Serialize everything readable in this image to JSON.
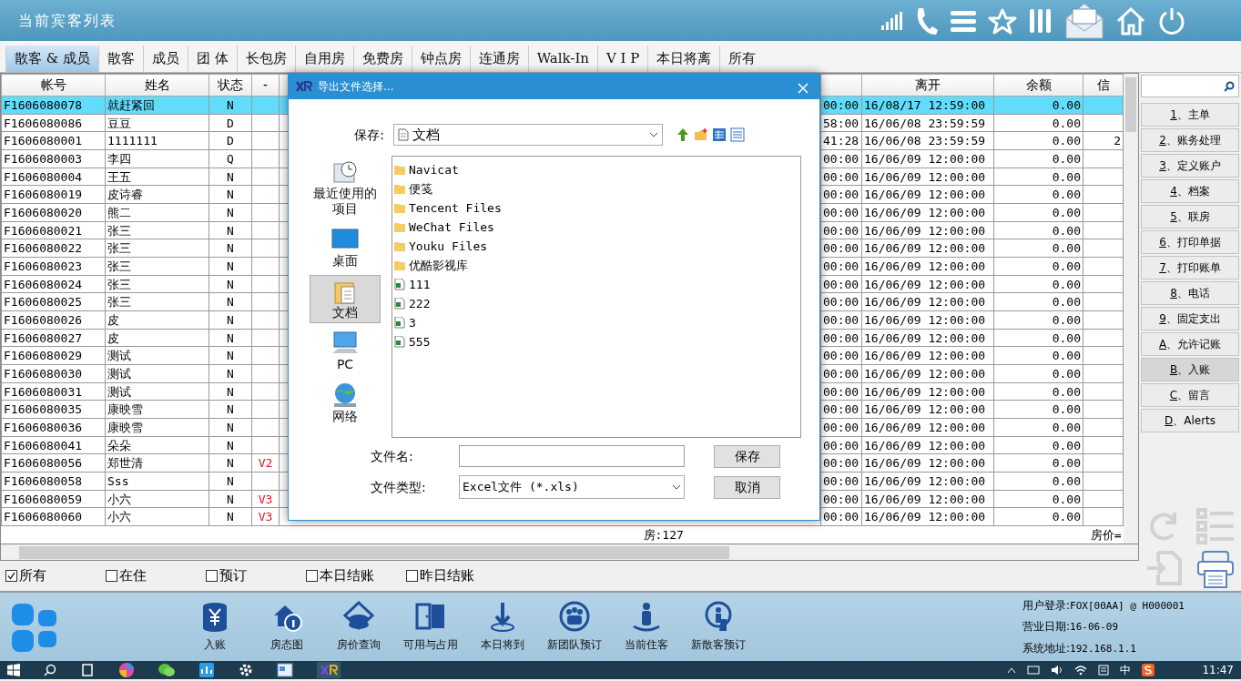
{
  "title_bar": {
    "title": "当前宾客列表"
  },
  "tabs": [
    {
      "label": "散客 & 成员",
      "selected": true
    },
    {
      "label": "散客",
      "selected": false
    },
    {
      "label": "成员",
      "selected": false
    },
    {
      "label": "团 体",
      "selected": false
    },
    {
      "label": "长包房",
      "selected": false
    },
    {
      "label": "自用房",
      "selected": false
    },
    {
      "label": "免费房",
      "selected": false
    },
    {
      "label": "钟点房",
      "selected": false
    },
    {
      "label": "连通房",
      "selected": false
    },
    {
      "label": "Walk-In",
      "selected": false
    },
    {
      "label": "V I P",
      "selected": false
    },
    {
      "label": "本日将离",
      "selected": false
    },
    {
      "label": "所有",
      "selected": false
    }
  ],
  "table": {
    "columns": [
      "帐号",
      "姓名",
      "状态",
      "-",
      "离开",
      "余额",
      "信"
    ],
    "rows": [
      {
        "account": "F1606080078",
        "name": "就赶紧回",
        "status": "N",
        "column_4": "",
        "column_6": "00:00",
        "leave": "16/08/17 12:59:00",
        "balance": "0.00",
        "column_9": "",
        "selected": true
      },
      {
        "account": "F1606080086",
        "name": "豆豆",
        "status": "D",
        "column_6": "58:00",
        "leave": "16/06/08 23:59:59",
        "balance": "0.00",
        "selected": false
      },
      {
        "account": "F1606080001",
        "name": "1111111",
        "status": "D",
        "column_6": "41:28",
        "leave": "16/06/08 23:59:59",
        "balance": "0.00",
        "column_9": "2",
        "selected": false
      },
      {
        "account": "F1606080003",
        "name": "李四",
        "status": "Q",
        "column_6": "00:00",
        "leave": "16/06/09 12:00:00",
        "balance": "0.00",
        "selected": false
      },
      {
        "account": "F1606080004",
        "name": "王五",
        "status": "N",
        "column_6": "00:00",
        "leave": "16/06/09 12:00:00",
        "balance": "0.00",
        "selected": false
      },
      {
        "account": "F1606080019",
        "name": "皮诗睿",
        "status": "N",
        "column_6": "00:00",
        "leave": "16/06/09 12:00:00",
        "balance": "0.00",
        "selected": false
      },
      {
        "account": "F1606080020",
        "name": "熊二",
        "status": "N",
        "column_6": "00:00",
        "leave": "16/06/09 12:00:00",
        "balance": "0.00",
        "selected": false
      },
      {
        "account": "F1606080021",
        "name": "张三",
        "status": "N",
        "column_6": "00:00",
        "leave": "16/06/09 12:00:00",
        "balance": "0.00",
        "selected": false
      },
      {
        "account": "F1606080022",
        "name": "张三",
        "status": "N",
        "column_6": "00:00",
        "leave": "16/06/09 12:00:00",
        "balance": "0.00",
        "selected": false
      },
      {
        "account": "F1606080023",
        "name": "张三",
        "status": "N",
        "column_6": "00:00",
        "leave": "16/06/09 12:00:00",
        "balance": "0.00",
        "selected": false
      },
      {
        "account": "F1606080024",
        "name": "张三",
        "status": "N",
        "column_6": "00:00",
        "leave": "16/06/09 12:00:00",
        "balance": "0.00",
        "selected": false
      },
      {
        "account": "F1606080025",
        "name": "张三",
        "status": "N",
        "column_6": "00:00",
        "leave": "16/06/09 12:00:00",
        "balance": "0.00",
        "selected": false
      },
      {
        "account": "F1606080026",
        "name": "皮",
        "status": "N",
        "column_6": "00:00",
        "leave": "16/06/09 12:00:00",
        "balance": "0.00",
        "selected": false
      },
      {
        "account": "F1606080027",
        "name": "皮",
        "status": "N",
        "column_6": "00:00",
        "leave": "16/06/09 12:00:00",
        "balance": "0.00",
        "selected": false
      },
      {
        "account": "F1606080029",
        "name": "测试",
        "status": "N",
        "column_6": "00:00",
        "leave": "16/06/09 12:00:00",
        "balance": "0.00",
        "selected": false
      },
      {
        "account": "F1606080030",
        "name": "测试",
        "status": "N",
        "column_6": "00:00",
        "leave": "16/06/09 12:00:00",
        "balance": "0.00",
        "selected": false
      },
      {
        "account": "F1606080031",
        "name": "测试",
        "status": "N",
        "column_6": "00:00",
        "leave": "16/06/09 12:00:00",
        "balance": "0.00",
        "selected": false
      },
      {
        "account": "F1606080035",
        "name": "康映雪",
        "status": "N",
        "column_6": "00:00",
        "leave": "16/06/09 12:00:00",
        "balance": "0.00",
        "selected": false
      },
      {
        "account": "F1606080036",
        "name": "康映雪",
        "status": "N",
        "column_6": "00:00",
        "leave": "16/06/09 12:00:00",
        "balance": "0.00",
        "selected": false
      },
      {
        "account": "F1606080041",
        "name": "朵朵",
        "status": "N",
        "column_6": "00:00",
        "leave": "16/06/09 12:00:00",
        "balance": "0.00",
        "selected": false
      },
      {
        "account": "F1606080056",
        "name": "郑世清",
        "status": "N",
        "column_4": "V2",
        "column_6": "00:00",
        "leave": "16/06/09 12:00:00",
        "balance": "0.00",
        "selected": false
      },
      {
        "account": "F1606080058",
        "name": "Sss",
        "status": "N",
        "column_6": "00:00",
        "leave": "16/06/09 12:00:00",
        "balance": "0.00",
        "selected": false
      },
      {
        "account": "F1606080059",
        "name": "小六",
        "status": "N",
        "column_4": "V3",
        "column_6": "00:00",
        "leave": "16/06/09 12:00:00",
        "balance": "0.00",
        "selected": false
      },
      {
        "account": "F1606080060",
        "name": "小六",
        "status": "N",
        "column_4": "V3",
        "column_6": "00:00",
        "leave": "16/06/09 12:00:00",
        "balance": "0.00",
        "selected": false
      }
    ],
    "summary": {
      "rooms": "房:127",
      "rate_label": "房价="
    }
  },
  "filters": [
    {
      "label": "所有",
      "checked": true
    },
    {
      "label": "在住",
      "checked": false
    },
    {
      "label": "预订",
      "checked": false
    },
    {
      "label": "本日结账",
      "checked": false
    },
    {
      "label": "昨日结账",
      "checked": false
    }
  ],
  "side_buttons": [
    {
      "key": "1",
      "label": "、主单",
      "selected": false
    },
    {
      "key": "2",
      "label": "、账务处理",
      "selected": false
    },
    {
      "key": "3",
      "label": "、定义账户",
      "selected": false
    },
    {
      "key": "4",
      "label": "、档案",
      "selected": false
    },
    {
      "key": "5",
      "label": "、联房",
      "selected": false
    },
    {
      "key": "6",
      "label": "、打印单据",
      "selected": false
    },
    {
      "key": "7",
      "label": "、打印账单",
      "selected": false
    },
    {
      "key": "8",
      "label": "、电话",
      "selected": false
    },
    {
      "key": "9",
      "label": "、固定支出",
      "selected": false
    },
    {
      "key": "A",
      "label": "、允许记账",
      "selected": false
    },
    {
      "key": "B",
      "label": "、入账",
      "selected": true
    },
    {
      "key": "C",
      "label": "、留言",
      "selected": false
    },
    {
      "key": "D",
      "label": "、Alerts",
      "selected": false
    }
  ],
  "dialog": {
    "title": "导出文件选择...",
    "save_in_label": "保存:",
    "location": "文档",
    "places": [
      {
        "label": "最近使用的项目",
        "kind": "recent",
        "selected": false
      },
      {
        "label": "桌面",
        "kind": "desktop",
        "selected": false
      },
      {
        "label": "文档",
        "kind": "documents",
        "selected": true
      },
      {
        "label": "PC",
        "kind": "pc",
        "selected": false
      },
      {
        "label": "网络",
        "kind": "network",
        "selected": false
      }
    ],
    "files": [
      {
        "name": "Navicat",
        "kind": "folder"
      },
      {
        "name": "便笺",
        "kind": "folder"
      },
      {
        "name": "Tencent Files",
        "kind": "folder"
      },
      {
        "name": "WeChat Files",
        "kind": "folder"
      },
      {
        "name": "Youku Files",
        "kind": "folder"
      },
      {
        "name": "优酷影视库",
        "kind": "folder"
      },
      {
        "name": "111",
        "kind": "sheet"
      },
      {
        "name": "222",
        "kind": "sheet"
      },
      {
        "name": "3",
        "kind": "sheet"
      },
      {
        "name": "555",
        "kind": "sheet"
      }
    ],
    "filename_label": "文件名:",
    "filetype_label": "文件类型:",
    "filetype": "Excel文件 (*.xls)",
    "buttons": [
      "保存",
      "取消"
    ]
  },
  "toolbar": [
    {
      "label": "入账",
      "kind": "deposit"
    },
    {
      "label": "房态图",
      "kind": "room_status"
    },
    {
      "label": "房价查询",
      "kind": "rate"
    },
    {
      "label": "可用与占用",
      "kind": "availability"
    },
    {
      "label": "本日将到",
      "kind": "arrivals"
    },
    {
      "label": "新团队预订",
      "kind": "group"
    },
    {
      "label": "当前住客",
      "kind": "guest"
    },
    {
      "label": "新散客预订",
      "kind": "booking"
    }
  ],
  "login_info": [
    {
      "label": "用户登录:",
      "value": "FOX[00AA] @ H000001"
    },
    {
      "label": "营业日期:",
      "value": "16-06-09"
    },
    {
      "label": "系统地址:",
      "value": "192.168.1.1"
    }
  ],
  "taskbar": {
    "ime": "中",
    "clock": "11:47"
  }
}
